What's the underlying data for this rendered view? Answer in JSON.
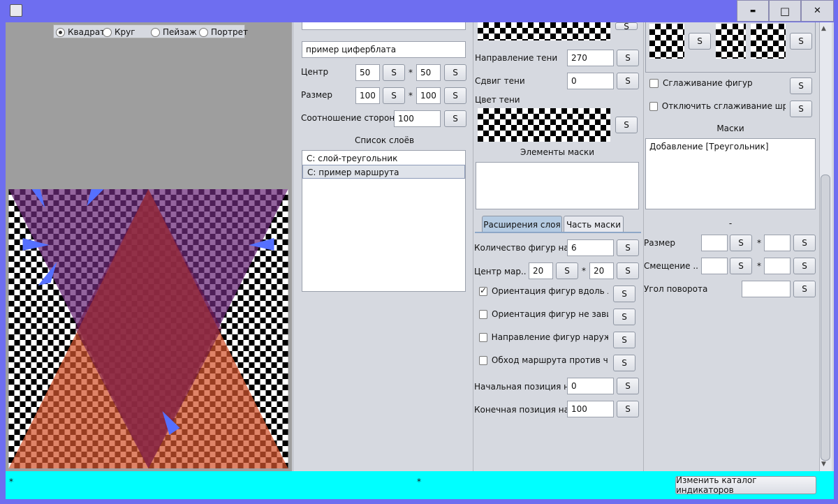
{
  "window": {
    "minimize_icon": "minimize-icon",
    "maximize_icon": "maximize-icon",
    "close_icon": "close-icon",
    "minimize_glyph": "▬",
    "maximize_glyph": "□",
    "close_glyph": "✕"
  },
  "preview": {
    "modes": [
      {
        "label": "Квадрат",
        "selected": true
      },
      {
        "label": "Круг",
        "selected": false
      },
      {
        "label": "Пейзаж",
        "selected": false
      },
      {
        "label": "Портрет",
        "selected": false
      }
    ],
    "colors": {
      "purple": "#6b2a78",
      "orange": "#d2542e",
      "marker": "#5570ff"
    }
  },
  "layer_panel": {
    "top_field": "",
    "name_field": "пример циферблата",
    "center_label": "Центр",
    "center_x": "50",
    "center_y": "50",
    "size_label": "Размер",
    "size_x": "100",
    "size_y": "100",
    "ratio_label": "Соотношение сторон",
    "ratio_value": "100",
    "times": "*",
    "s": "S",
    "layers_title": "Список слоёв",
    "layers": [
      "С: слой-треугольник",
      "С: пример маршрута"
    ],
    "selected_layer": 1
  },
  "shadow_panel": {
    "direction_label": "Направление тени",
    "direction_value": "270",
    "offset_label": "Сдвиг тени",
    "offset_value": "0",
    "color_label": "Цвет тени",
    "mask_elements_title": "Элементы маски"
  },
  "tabs": [
    "Расширения слоя",
    "Часть маски"
  ],
  "active_tab": 0,
  "extension": {
    "shape_count_label": "Количество фигур на ма",
    "shape_count_value": "6",
    "route_center_label": "Центр мар...",
    "route_center_x": "20",
    "route_center_y": "20",
    "checkboxes": [
      {
        "label": "Ориентация фигур вдоль л...",
        "checked": true
      },
      {
        "label": "Ориентация фигур не зави...",
        "checked": false
      },
      {
        "label": "Направление фигур наружу...",
        "checked": false
      },
      {
        "label": "Обход маршрута против ча...",
        "checked": false
      }
    ],
    "start_label": "Начальная позиция на",
    "start_value": "0",
    "end_label": "Конечная позиция на м",
    "end_value": "100"
  },
  "right_panel": {
    "smoothing_label": "Сглаживание фигур",
    "disable_font_smoothing_label": "Отключить сглаживание шри...",
    "masks_title": "Маски",
    "masks": [
      "Добавление [Треугольник]"
    ],
    "dash": "-",
    "size_label": "Размер",
    "offset_label": "Смещение ...",
    "rotation_label": "Угол поворота"
  },
  "status": {
    "left_mark": "*",
    "center_mark": "*",
    "catalog_button": "Изменить каталог индикаторов"
  }
}
